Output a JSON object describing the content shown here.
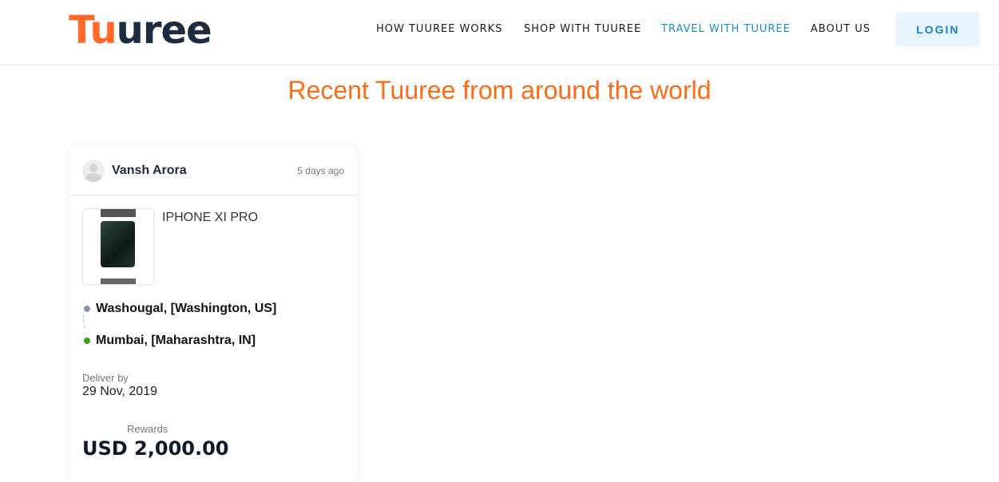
{
  "header": {
    "logo_a": "Tu",
    "logo_b": "uree",
    "nav": [
      "HOW TUUREE WORKS",
      "SHOP WITH TUUREE",
      "TRAVEL WITH TUUREE",
      "ABOUT US"
    ],
    "login": "LOGIN"
  },
  "main": {
    "title": "Recent Tuuree from around the world"
  },
  "card": {
    "user": "Vansh Arora",
    "time": "5 days ago",
    "product": "IPHONE XI PRO",
    "from": "Washougal, [Washington, US]",
    "to": "Mumbai, [Maharashtra, IN]",
    "deliver_label": "Deliver by",
    "deliver_date": "29 Nov, 2019",
    "rewards_label": "Rewards",
    "rewards_amount": "USD 2,000.00"
  },
  "colors": {
    "brand_orange": "#ff6a2b",
    "accent_blue": "#1a8ad0",
    "from_dot": "#8a95a3",
    "to_dot": "#3aa10f"
  }
}
